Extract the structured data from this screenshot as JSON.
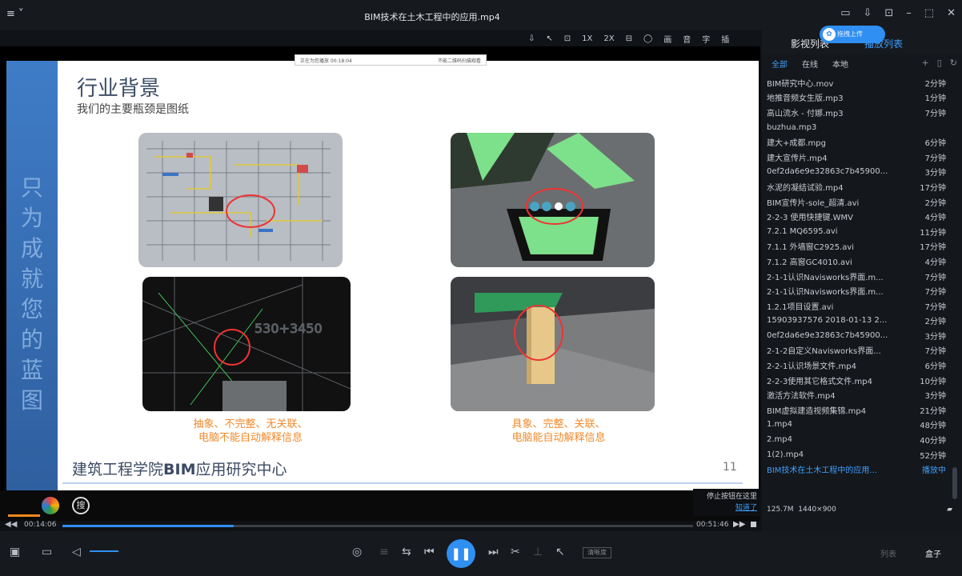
{
  "window": {
    "title": "BIM技术在土木工程中的应用.mp4",
    "menu_icon": "≡ ˅",
    "controls": [
      "▭",
      "⇩",
      "⊡",
      "–",
      "⬚",
      "✕"
    ]
  },
  "video_toolbar": [
    "⇩",
    "↖",
    "⊡",
    "1X",
    "2X",
    "⊟",
    "◯",
    "画",
    "音",
    "字",
    "插"
  ],
  "slide": {
    "title": "行业背景",
    "subtitle": "我们的主要瓶颈是图纸",
    "vertical_text": "只为成就您的蓝图",
    "caption_left": "抽象、不完整、无关联、\n电脑不能自动解释信息",
    "caption_right": "具象、完整、关联、\n电脑能自动解释信息",
    "footer_org": "建筑工程学院",
    "footer_bim": "BIM",
    "footer_rest": "应用研究中心",
    "page_number": "11",
    "top_overlay_left": "正在为您播放 00:18:04",
    "top_overlay_right": "不能二维码扫描观看"
  },
  "hint": {
    "text": "停止按钮在这里",
    "link": "知道了"
  },
  "progress": {
    "current": "00:14:06",
    "total": "00:51:46",
    "fraction": 0.272
  },
  "controls": {
    "quality": "清晰度",
    "tab_list": "列表",
    "tab_box": "盒子"
  },
  "panel": {
    "tab_library": "影视列表",
    "tab_playlist": "播放列表",
    "upload": "拖拽上传",
    "filters": [
      "全部",
      "在线",
      "本地"
    ],
    "items": [
      {
        "name": "BIM研究中心.mov",
        "dur": "2分钟"
      },
      {
        "name": "地推音频女生版.mp3",
        "dur": "1分钟"
      },
      {
        "name": "高山流水 - 付娜.mp3",
        "dur": "7分钟"
      },
      {
        "name": "buzhua.mp3",
        "dur": ""
      },
      {
        "name": "建大+成都.mpg",
        "dur": "6分钟"
      },
      {
        "name": "建大宣传片.mp4",
        "dur": "7分钟"
      },
      {
        "name": "0ef2da6e9e32863c7b45900...",
        "dur": "3分钟"
      },
      {
        "name": "水泥的凝结试验.mp4",
        "dur": "17分钟"
      },
      {
        "name": "BIM宣传片-sole_超清.avi",
        "dur": "2分钟"
      },
      {
        "name": "2-2-3 使用快捷键.WMV",
        "dur": "4分钟"
      },
      {
        "name": "7.2.1 MQ6595.avi",
        "dur": "11分钟"
      },
      {
        "name": "7.1.1 外墙窗C2925.avi",
        "dur": "17分钟"
      },
      {
        "name": "7.1.2 高窗GC4010.avi",
        "dur": "4分钟"
      },
      {
        "name": "2-1-1认识Navisworks界面.m...",
        "dur": "7分钟"
      },
      {
        "name": "2-1-1认识Navisworks界面.m...",
        "dur": "7分钟"
      },
      {
        "name": "1.2.1项目设置.avi",
        "dur": "7分钟"
      },
      {
        "name": "15903937576 2018-01-13 2...",
        "dur": "2分钟"
      },
      {
        "name": "0ef2da6e9e32863c7b45900...",
        "dur": "3分钟"
      },
      {
        "name": "2-1-2自定义Navisworks界面...",
        "dur": "7分钟"
      },
      {
        "name": "2-2-1认识场景文件.mp4",
        "dur": "6分钟"
      },
      {
        "name": "2-2-3使用其它格式文件.mp4",
        "dur": "10分钟"
      },
      {
        "name": "激活方法软件.mp4",
        "dur": "3分钟"
      },
      {
        "name": "BIM虚拟建造视频集锦.mp4",
        "dur": "21分钟"
      },
      {
        "name": "1.mp4",
        "dur": "48分钟"
      },
      {
        "name": "2.mp4",
        "dur": "40分钟"
      },
      {
        "name": "1(2).mp4",
        "dur": "52分钟"
      },
      {
        "name": "BIM技术在土木工程中的应用...",
        "dur": "播放中"
      }
    ],
    "meta_size": "125.7M",
    "meta_res": "1440×900"
  },
  "colors": {
    "accent": "#2f8ff2",
    "caption": "#f08a2c"
  }
}
